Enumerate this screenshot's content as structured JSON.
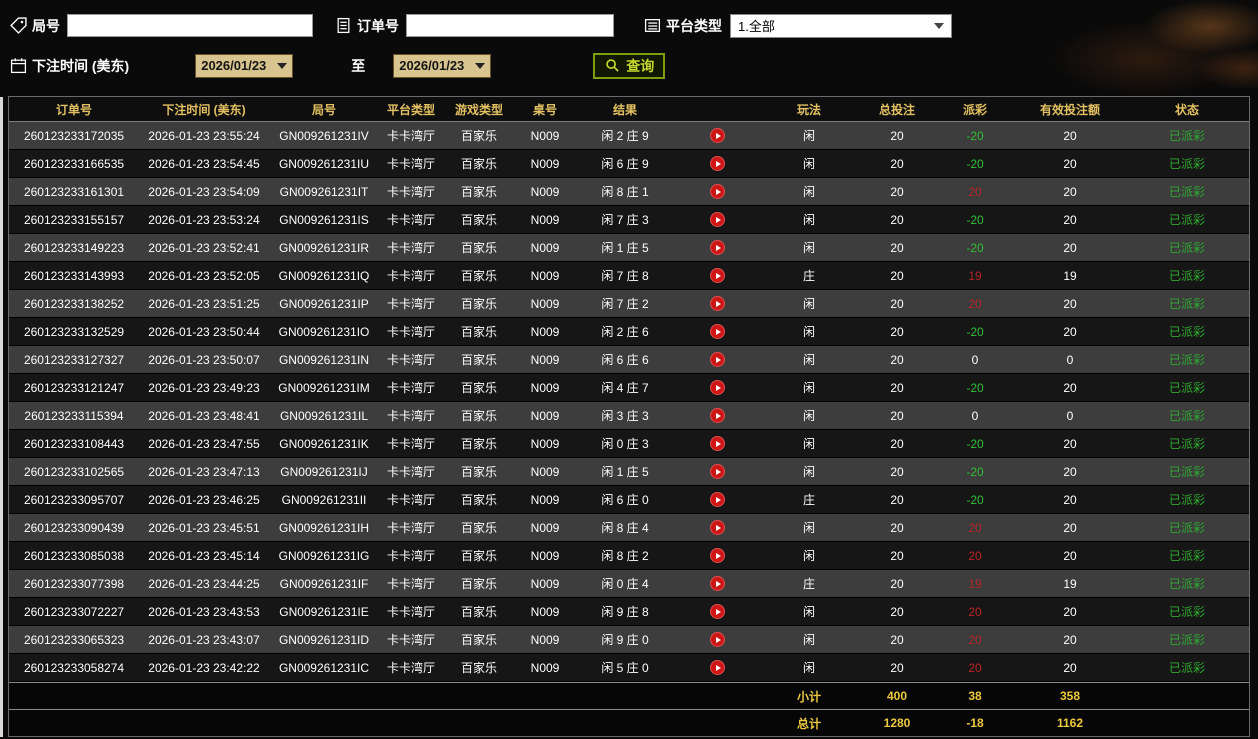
{
  "filters": {
    "round_no": {
      "label": "局号",
      "value": "",
      "icon": "tag-icon"
    },
    "order_no": {
      "label": "订单号",
      "value": "",
      "icon": "document-icon"
    },
    "platform_type": {
      "label": "平台类型",
      "value": "1.全部",
      "icon": "list-icon"
    },
    "bet_time": {
      "label": "下注时间 (美东)",
      "icon": "calendar-icon",
      "date_from": "2026/01/23",
      "to_label": "至",
      "date_to": "2026/01/23"
    },
    "query_button": {
      "label": "查询",
      "icon": "search-icon"
    }
  },
  "table": {
    "headers": [
      "订单号",
      "下注时间 (美东)",
      "局号",
      "平台类型",
      "游戏类型",
      "桌号",
      "结果",
      "玩法",
      "总投注",
      "派彩",
      "有效投注额",
      "状态"
    ],
    "rows": [
      {
        "order_id": "260123233172035",
        "bet_time": "2026-01-23 23:55:24",
        "round_id": "GN009261231IV",
        "platform": "卡卡湾厅",
        "game": "百家乐",
        "table_no": "N009",
        "result": "闲 2 庄 9",
        "play": "闲",
        "total_bet": "20",
        "payout": "-20",
        "valid_bet": "20",
        "status": "已派彩"
      },
      {
        "order_id": "260123233166535",
        "bet_time": "2026-01-23 23:54:45",
        "round_id": "GN009261231IU",
        "platform": "卡卡湾厅",
        "game": "百家乐",
        "table_no": "N009",
        "result": "闲 6 庄 9",
        "play": "闲",
        "total_bet": "20",
        "payout": "-20",
        "valid_bet": "20",
        "status": "已派彩"
      },
      {
        "order_id": "260123233161301",
        "bet_time": "2026-01-23 23:54:09",
        "round_id": "GN009261231IT",
        "platform": "卡卡湾厅",
        "game": "百家乐",
        "table_no": "N009",
        "result": "闲 8 庄 1",
        "play": "闲",
        "total_bet": "20",
        "payout": "20",
        "valid_bet": "20",
        "status": "已派彩"
      },
      {
        "order_id": "260123233155157",
        "bet_time": "2026-01-23 23:53:24",
        "round_id": "GN009261231IS",
        "platform": "卡卡湾厅",
        "game": "百家乐",
        "table_no": "N009",
        "result": "闲 7 庄 3",
        "play": "闲",
        "total_bet": "20",
        "payout": "-20",
        "valid_bet": "20",
        "status": "已派彩"
      },
      {
        "order_id": "260123233149223",
        "bet_time": "2026-01-23 23:52:41",
        "round_id": "GN009261231IR",
        "platform": "卡卡湾厅",
        "game": "百家乐",
        "table_no": "N009",
        "result": "闲 1 庄 5",
        "play": "闲",
        "total_bet": "20",
        "payout": "-20",
        "valid_bet": "20",
        "status": "已派彩"
      },
      {
        "order_id": "260123233143993",
        "bet_time": "2026-01-23 23:52:05",
        "round_id": "GN009261231IQ",
        "platform": "卡卡湾厅",
        "game": "百家乐",
        "table_no": "N009",
        "result": "闲 7 庄 8",
        "play": "庄",
        "total_bet": "20",
        "payout": "19",
        "valid_bet": "19",
        "status": "已派彩"
      },
      {
        "order_id": "260123233138252",
        "bet_time": "2026-01-23 23:51:25",
        "round_id": "GN009261231IP",
        "platform": "卡卡湾厅",
        "game": "百家乐",
        "table_no": "N009",
        "result": "闲 7 庄 2",
        "play": "闲",
        "total_bet": "20",
        "payout": "20",
        "valid_bet": "20",
        "status": "已派彩"
      },
      {
        "order_id": "260123233132529",
        "bet_time": "2026-01-23 23:50:44",
        "round_id": "GN009261231IO",
        "platform": "卡卡湾厅",
        "game": "百家乐",
        "table_no": "N009",
        "result": "闲 2 庄 6",
        "play": "闲",
        "total_bet": "20",
        "payout": "-20",
        "valid_bet": "20",
        "status": "已派彩"
      },
      {
        "order_id": "260123233127327",
        "bet_time": "2026-01-23 23:50:07",
        "round_id": "GN009261231IN",
        "platform": "卡卡湾厅",
        "game": "百家乐",
        "table_no": "N009",
        "result": "闲 6 庄 6",
        "play": "闲",
        "total_bet": "20",
        "payout": "0",
        "valid_bet": "0",
        "status": "已派彩"
      },
      {
        "order_id": "260123233121247",
        "bet_time": "2026-01-23 23:49:23",
        "round_id": "GN009261231IM",
        "platform": "卡卡湾厅",
        "game": "百家乐",
        "table_no": "N009",
        "result": "闲 4 庄 7",
        "play": "闲",
        "total_bet": "20",
        "payout": "-20",
        "valid_bet": "20",
        "status": "已派彩"
      },
      {
        "order_id": "260123233115394",
        "bet_time": "2026-01-23 23:48:41",
        "round_id": "GN009261231IL",
        "platform": "卡卡湾厅",
        "game": "百家乐",
        "table_no": "N009",
        "result": "闲 3 庄 3",
        "play": "闲",
        "total_bet": "20",
        "payout": "0",
        "valid_bet": "0",
        "status": "已派彩"
      },
      {
        "order_id": "260123233108443",
        "bet_time": "2026-01-23 23:47:55",
        "round_id": "GN009261231IK",
        "platform": "卡卡湾厅",
        "game": "百家乐",
        "table_no": "N009",
        "result": "闲 0 庄 3",
        "play": "闲",
        "total_bet": "20",
        "payout": "-20",
        "valid_bet": "20",
        "status": "已派彩"
      },
      {
        "order_id": "260123233102565",
        "bet_time": "2026-01-23 23:47:13",
        "round_id": "GN009261231IJ",
        "platform": "卡卡湾厅",
        "game": "百家乐",
        "table_no": "N009",
        "result": "闲 1 庄 5",
        "play": "闲",
        "total_bet": "20",
        "payout": "-20",
        "valid_bet": "20",
        "status": "已派彩"
      },
      {
        "order_id": "260123233095707",
        "bet_time": "2026-01-23 23:46:25",
        "round_id": "GN009261231II",
        "platform": "卡卡湾厅",
        "game": "百家乐",
        "table_no": "N009",
        "result": "闲 6 庄 0",
        "play": "庄",
        "total_bet": "20",
        "payout": "-20",
        "valid_bet": "20",
        "status": "已派彩"
      },
      {
        "order_id": "260123233090439",
        "bet_time": "2026-01-23 23:45:51",
        "round_id": "GN009261231IH",
        "platform": "卡卡湾厅",
        "game": "百家乐",
        "table_no": "N009",
        "result": "闲 8 庄 4",
        "play": "闲",
        "total_bet": "20",
        "payout": "20",
        "valid_bet": "20",
        "status": "已派彩"
      },
      {
        "order_id": "260123233085038",
        "bet_time": "2026-01-23 23:45:14",
        "round_id": "GN009261231IG",
        "platform": "卡卡湾厅",
        "game": "百家乐",
        "table_no": "N009",
        "result": "闲 8 庄 2",
        "play": "闲",
        "total_bet": "20",
        "payout": "20",
        "valid_bet": "20",
        "status": "已派彩"
      },
      {
        "order_id": "260123233077398",
        "bet_time": "2026-01-23 23:44:25",
        "round_id": "GN009261231IF",
        "platform": "卡卡湾厅",
        "game": "百家乐",
        "table_no": "N009",
        "result": "闲 0 庄 4",
        "play": "庄",
        "total_bet": "20",
        "payout": "19",
        "valid_bet": "19",
        "status": "已派彩"
      },
      {
        "order_id": "260123233072227",
        "bet_time": "2026-01-23 23:43:53",
        "round_id": "GN009261231IE",
        "platform": "卡卡湾厅",
        "game": "百家乐",
        "table_no": "N009",
        "result": "闲 9 庄 8",
        "play": "闲",
        "total_bet": "20",
        "payout": "20",
        "valid_bet": "20",
        "status": "已派彩"
      },
      {
        "order_id": "260123233065323",
        "bet_time": "2026-01-23 23:43:07",
        "round_id": "GN009261231ID",
        "platform": "卡卡湾厅",
        "game": "百家乐",
        "table_no": "N009",
        "result": "闲 9 庄 0",
        "play": "闲",
        "total_bet": "20",
        "payout": "20",
        "valid_bet": "20",
        "status": "已派彩"
      },
      {
        "order_id": "260123233058274",
        "bet_time": "2026-01-23 23:42:22",
        "round_id": "GN009261231IC",
        "platform": "卡卡湾厅",
        "game": "百家乐",
        "table_no": "N009",
        "result": "闲 5 庄 0",
        "play": "闲",
        "total_bet": "20",
        "payout": "20",
        "valid_bet": "20",
        "status": "已派彩"
      }
    ],
    "subtotal": {
      "label": "小计",
      "total_bet": "400",
      "payout": "38",
      "valid_bet": "358"
    },
    "total": {
      "label": "总计",
      "total_bet": "1280",
      "payout": "-18",
      "valid_bet": "1162"
    }
  },
  "colors": {
    "header_text": "#e3c162",
    "footer_text": "#edc93f",
    "payout_positive": "#b42424",
    "payout_negative": "#36bd36",
    "status_paid": "#2fa82f",
    "row_light": "#3d3d3d",
    "row_dark": "#161616",
    "date_box_bg": "#d8c48e",
    "query_accent": "#c6d92c",
    "play_button": "#cf1616"
  }
}
